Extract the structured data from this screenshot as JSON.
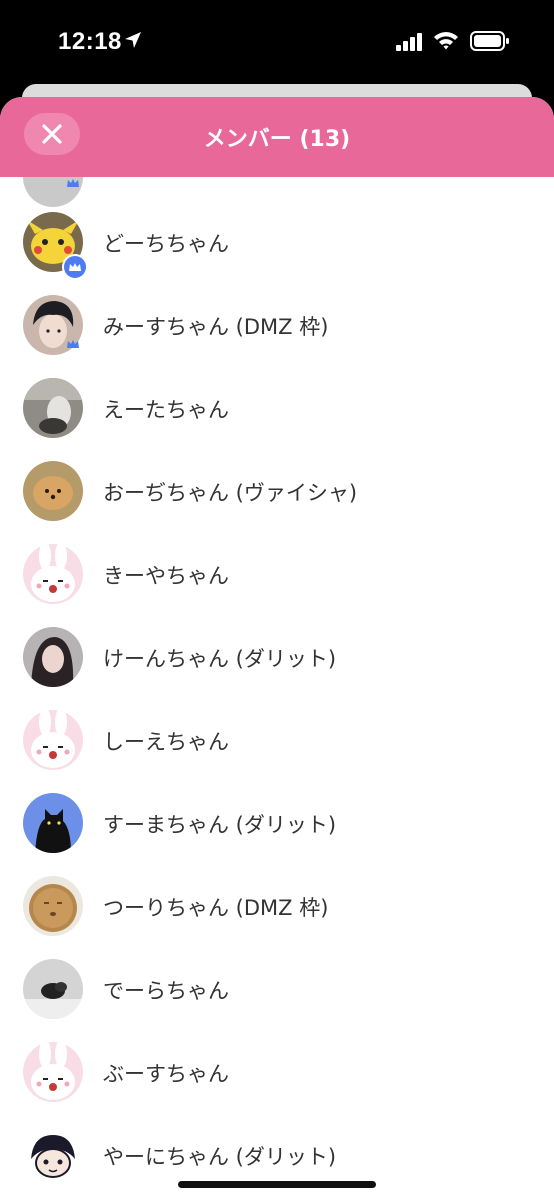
{
  "status_bar": {
    "time": "12:18"
  },
  "header": {
    "title": "メンバー (13)"
  },
  "members": [
    {
      "name": "どーちちゃん"
    },
    {
      "name": "みーすちゃん (DMZ 枠)"
    },
    {
      "name": "えーたちゃん"
    },
    {
      "name": "おーぢちゃん (ヴァイシャ)"
    },
    {
      "name": "きーやちゃん"
    },
    {
      "name": "けーんちゃん (ダリット)"
    },
    {
      "name": "しーえちゃん"
    },
    {
      "name": "すーまちゃん (ダリット)"
    },
    {
      "name": "つーりちゃん (DMZ 枠)"
    },
    {
      "name": "でーらちゃん"
    },
    {
      "name": "ぶーすちゃん"
    },
    {
      "name": "やーにちゃん (ダリット)"
    }
  ],
  "colors": {
    "header": "#e8689a",
    "badge": "#4f7bf0"
  }
}
